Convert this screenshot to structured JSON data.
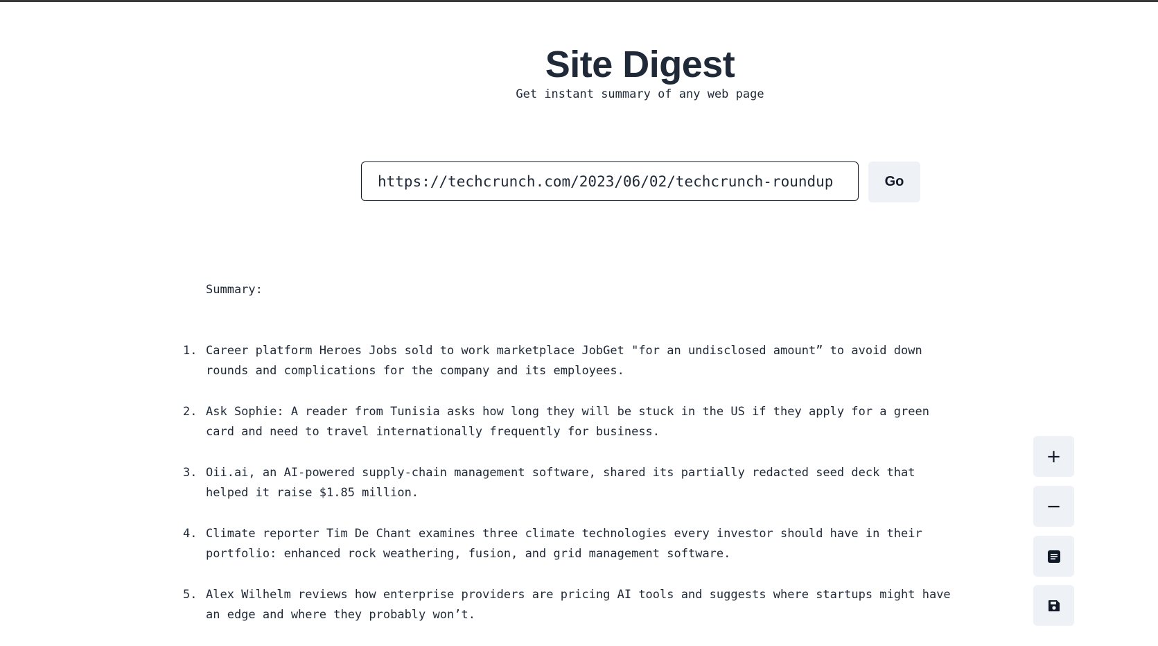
{
  "header": {
    "title": "Site Digest",
    "subtitle": "Get instant summary of any web page"
  },
  "search": {
    "url_value": "https://techcrunch.com/2023/06/02/techcrunch-roundup",
    "go_label": "Go"
  },
  "summary": {
    "label": "Summary:",
    "items": [
      {
        "num": "1.",
        "text": "Career platform Heroes Jobs sold to work marketplace JobGet \"for an undisclosed amount” to avoid down rounds and complications for the company and its employees."
      },
      {
        "num": "2.",
        "text": "Ask Sophie: A reader from Tunisia asks how long they will be stuck in the US if they apply for a green card and need to travel internationally frequently for business."
      },
      {
        "num": "3.",
        "text": "Oii.ai, an AI-powered supply-chain management software, shared its partially redacted seed deck that helped it raise $1.85 million."
      },
      {
        "num": "4.",
        "text": "Climate reporter Tim De Chant examines three climate technologies every investor should have in their portfolio: enhanced rock weathering, fusion, and grid management software."
      },
      {
        "num": "5.",
        "text": "Alex Wilhelm reviews how enterprise providers are pricing AI tools and suggests where startups might have an edge and where they probably won’t."
      }
    ]
  },
  "toolbar": {
    "zoom_in_icon": "plus-icon",
    "zoom_out_icon": "minus-icon",
    "document_icon": "document-icon",
    "save_icon": "save-icon",
    "plus_glyph": "+",
    "minus_glyph": "−"
  },
  "colors": {
    "text": "#1f2937",
    "button_bg": "#eef1f5",
    "input_border": "#111827"
  }
}
